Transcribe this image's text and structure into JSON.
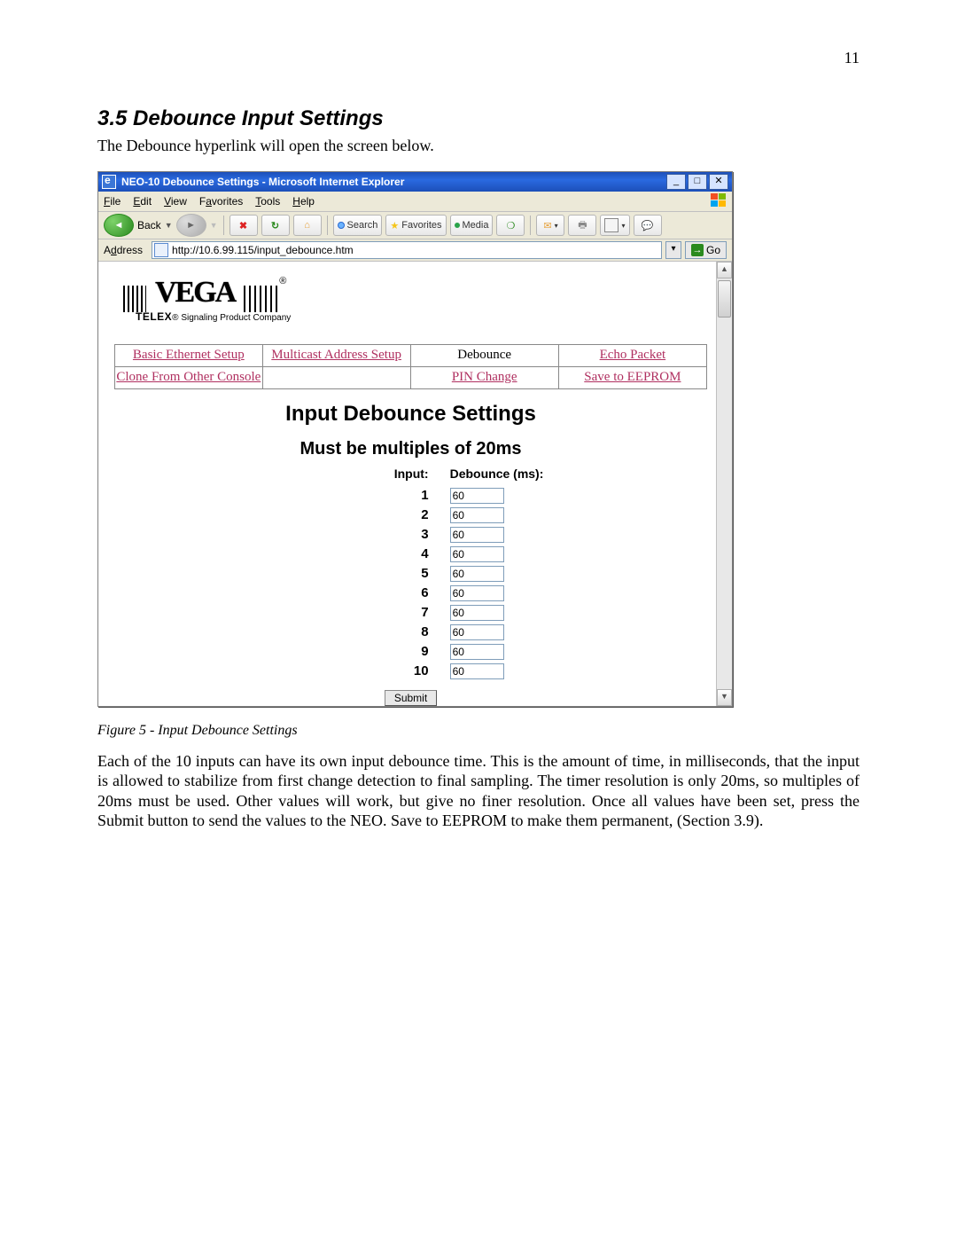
{
  "page_number": "11",
  "heading": "3.5  Debounce Input Settings",
  "intro": "The Debounce hyperlink will open the screen below.",
  "figure_caption": "Figure 5 - Input Debounce Settings",
  "body_paragraph": "Each of the 10 inputs can have its own input debounce time.  This is the amount of time, in milliseconds, that the input is allowed to stabilize from first change detection to final sampling.  The timer resolution is only 20ms, so multiples of 20ms must be used.  Other values will work, but give no finer resolution.  Once all values have been set, press the Submit button to send the values to the NEO.  Save to EEPROM to make them permanent, (Section 3.9).",
  "browser": {
    "title": "NEO-10 Debounce Settings - Microsoft Internet Explorer",
    "menus": [
      "File",
      "Edit",
      "View",
      "Favorites",
      "Tools",
      "Help"
    ],
    "toolbar": {
      "back": "Back",
      "search": "Search",
      "favorites": "Favorites",
      "media": "Media"
    },
    "address_label": "Address",
    "url": "http://10.6.99.115/input_debounce.htm",
    "go": "Go"
  },
  "webpage": {
    "logo_sub": "TELEX® Signaling Product Company",
    "nav_row1": [
      "Basic Ethernet Setup",
      "Multicast Address Setup",
      "Debounce",
      "Echo Packet"
    ],
    "nav_row2": [
      "Clone From Other Console",
      "",
      "PIN Change",
      "Save to EEPROM"
    ],
    "current_nav": "Debounce",
    "h1": "Input Debounce Settings",
    "h2": "Must be multiples of 20ms",
    "col_input": "Input:",
    "col_debounce": "Debounce (ms):",
    "rows": [
      {
        "n": "1",
        "v": "60"
      },
      {
        "n": "2",
        "v": "60"
      },
      {
        "n": "3",
        "v": "60"
      },
      {
        "n": "4",
        "v": "60"
      },
      {
        "n": "5",
        "v": "60"
      },
      {
        "n": "6",
        "v": "60"
      },
      {
        "n": "7",
        "v": "60"
      },
      {
        "n": "8",
        "v": "60"
      },
      {
        "n": "9",
        "v": "60"
      },
      {
        "n": "10",
        "v": "60"
      }
    ],
    "submit": "Submit"
  }
}
